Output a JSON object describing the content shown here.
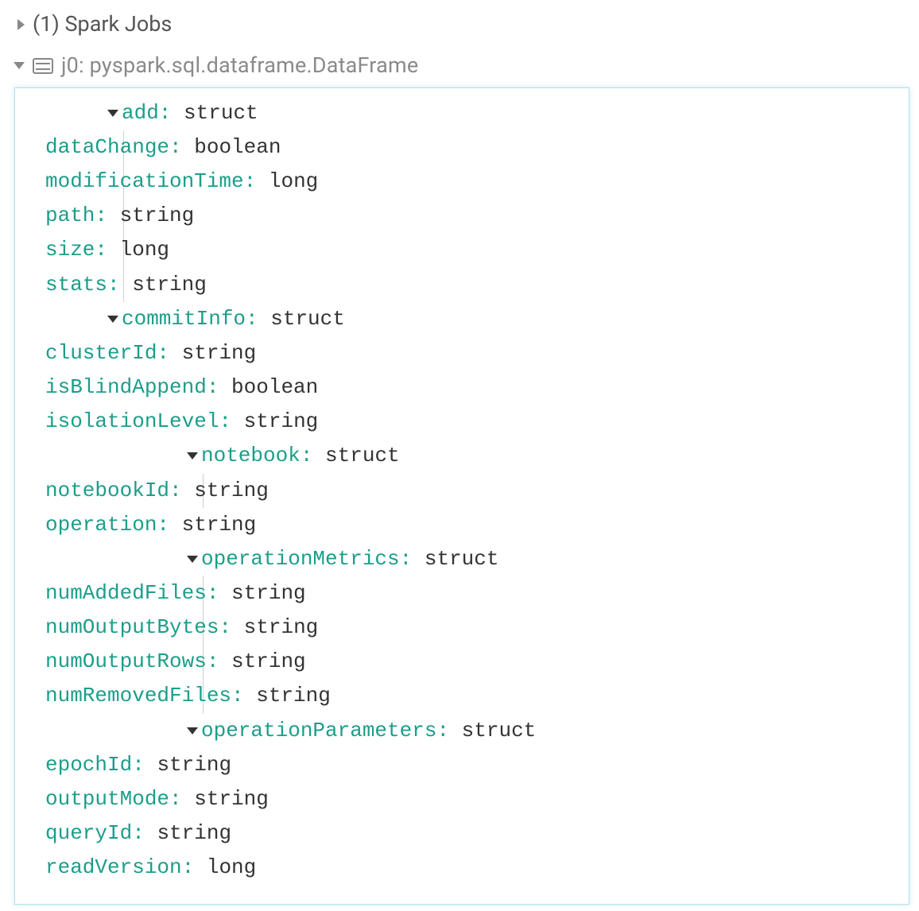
{
  "header": {
    "spark_jobs_label": "(1) Spark Jobs",
    "var_label": "j0:  pyspark.sql.dataframe.DataFrame"
  },
  "schema": {
    "add": {
      "name": "add:",
      "type": "struct",
      "fields": {
        "dataChange": {
          "name": "dataChange:",
          "type": "boolean"
        },
        "modificationTime": {
          "name": "modificationTime:",
          "type": "long"
        },
        "path": {
          "name": "path:",
          "type": "string"
        },
        "size": {
          "name": "size:",
          "type": "long"
        },
        "stats": {
          "name": "stats:",
          "type": "string"
        }
      }
    },
    "commitInfo": {
      "name": "commitInfo:",
      "type": "struct",
      "fields": {
        "clusterId": {
          "name": "clusterId:",
          "type": "string"
        },
        "isBlindAppend": {
          "name": "isBlindAppend:",
          "type": "boolean"
        },
        "isolationLevel": {
          "name": "isolationLevel:",
          "type": "string"
        },
        "notebook": {
          "name": "notebook:",
          "type": "struct",
          "fields": {
            "notebookId": {
              "name": "notebookId:",
              "type": "string"
            }
          }
        },
        "operation": {
          "name": "operation:",
          "type": "string"
        },
        "operationMetrics": {
          "name": "operationMetrics:",
          "type": "struct",
          "fields": {
            "numAddedFiles": {
              "name": "numAddedFiles:",
              "type": "string"
            },
            "numOutputBytes": {
              "name": "numOutputBytes:",
              "type": "string"
            },
            "numOutputRows": {
              "name": "numOutputRows:",
              "type": "string"
            },
            "numRemovedFiles": {
              "name": "numRemovedFiles:",
              "type": "string"
            }
          }
        },
        "operationParameters": {
          "name": "operationParameters:",
          "type": "struct",
          "fields": {
            "epochId": {
              "name": "epochId:",
              "type": "string"
            },
            "outputMode": {
              "name": "outputMode:",
              "type": "string"
            },
            "queryId": {
              "name": "queryId:",
              "type": "string"
            }
          }
        },
        "readVersion": {
          "name": "readVersion:",
          "type": "long"
        }
      }
    }
  }
}
